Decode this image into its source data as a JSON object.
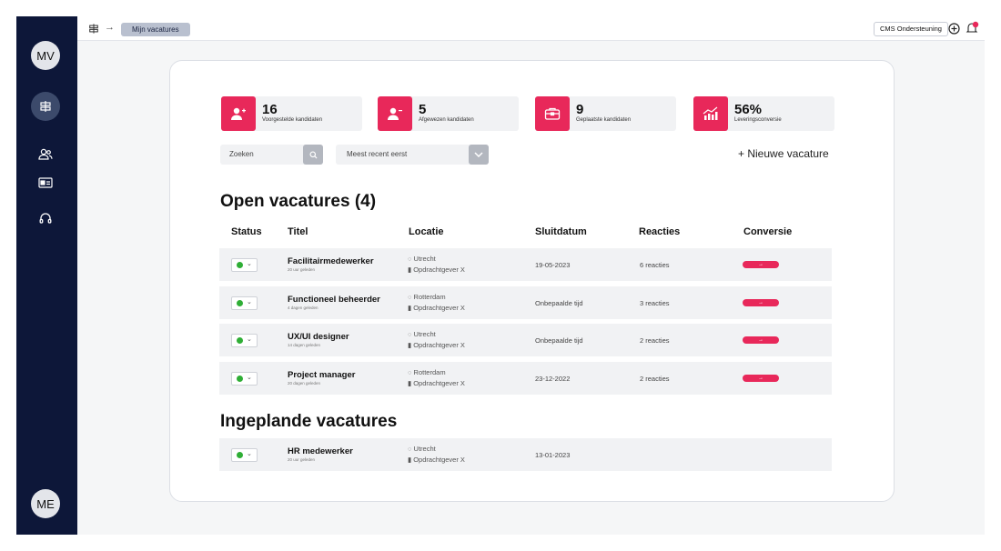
{
  "sidebar": {
    "top_avatar": "MV",
    "bottom_avatar": "ME",
    "items": [
      "signpost-icon",
      "users-icon",
      "id-card-icon",
      "headset-icon"
    ]
  },
  "topbar": {
    "breadcrumb_current": "Mijn vacatures",
    "cms_button": "CMS Ondersteuning"
  },
  "stats": [
    {
      "value": "16",
      "label": "Voorgestelde kandidaten",
      "icon": "user-plus-icon"
    },
    {
      "value": "5",
      "label": "Afgewezen kandidaten",
      "icon": "user-minus-icon"
    },
    {
      "value": "9",
      "label": "Geplaatste kandidaten",
      "icon": "briefcase-icon"
    },
    {
      "value": "56%",
      "label": "Leveringsconversie",
      "icon": "chart-up-icon"
    }
  ],
  "filters": {
    "search_placeholder": "Zoeken",
    "sort_value": "Meest recent eerst",
    "new_vacancy": "+  Nieuwe vacature"
  },
  "open_section": {
    "heading": "Open vacatures (4)",
    "columns": [
      "Status",
      "Titel",
      "Locatie",
      "Sluitdatum",
      "Reacties",
      "Conversie"
    ],
    "rows": [
      {
        "title": "Facilitairmedewerker",
        "sub": "20 uur geleden",
        "city": "Utrecht",
        "client": "Opdrachtgever X",
        "date": "19-05-2023",
        "responses": "6 reacties",
        "conv": "→"
      },
      {
        "title": "Functioneel beheerder",
        "sub": "4 dagen geleden",
        "city": "Rotterdam",
        "client": "Opdrachtgever X",
        "date": "Onbepaalde tijd",
        "responses": "3 reacties",
        "conv": "→"
      },
      {
        "title": "UX/UI designer",
        "sub": "14 dagen geleden",
        "city": "Utrecht",
        "client": "Opdrachtgever X",
        "date": "Onbepaalde tijd",
        "responses": "2 reacties",
        "conv": "→"
      },
      {
        "title": "Project manager",
        "sub": "20 dagen geleden",
        "city": "Rotterdam",
        "client": "Opdrachtgever X",
        "date": "23-12-2022",
        "responses": "2 reacties",
        "conv": "→"
      }
    ]
  },
  "planned_section": {
    "heading": "Ingeplande vacatures",
    "rows": [
      {
        "title": "HR medewerker",
        "sub": "20 uur geleden",
        "city": "Utrecht",
        "client": "Opdrachtgever X",
        "date": "13-01-2023"
      }
    ]
  },
  "colors": {
    "sidebar": "#0d1739",
    "accent": "#e8285a",
    "status_active": "#2fae36"
  }
}
